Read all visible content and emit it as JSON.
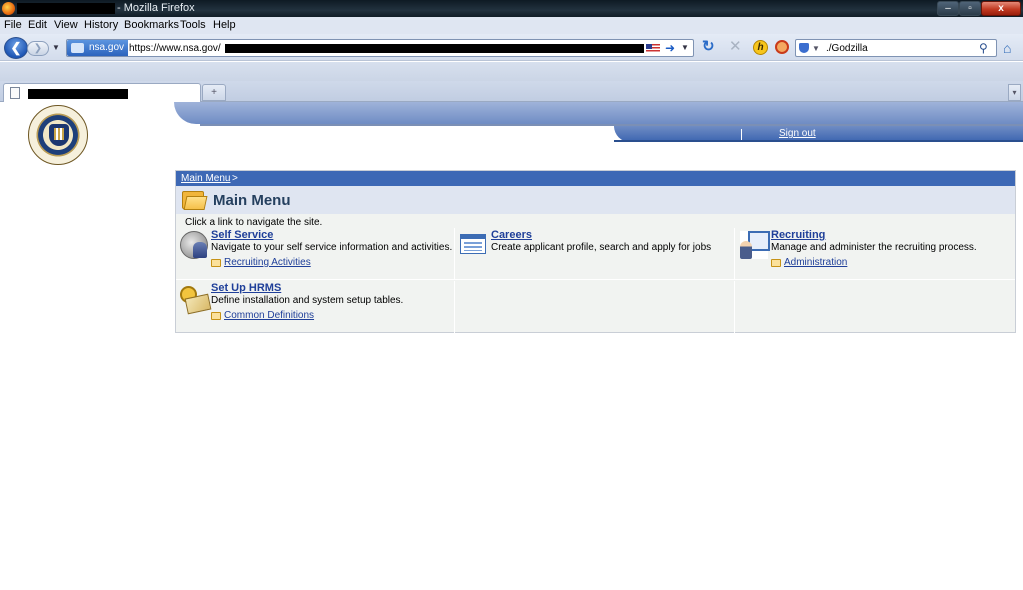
{
  "window": {
    "title_suffix": "- Mozilla Firefox",
    "buttons": {
      "minimize": "–",
      "maximize": "▫",
      "close": "x"
    }
  },
  "menubar": [
    "File",
    "Edit",
    "View",
    "History",
    "Bookmarks",
    "Tools",
    "Help"
  ],
  "navbar": {
    "identity_label": "nsa.gov",
    "url_visible": "https://www.nsa.gov/",
    "search_value": "./Godzilla"
  },
  "tabs": {
    "new_tab_label": "+",
    "list_label": "▾"
  },
  "site": {
    "signout_label": "Sign out"
  },
  "main_menu": {
    "breadcrumb": "Main Menu",
    "breadcrumb_sep": ">",
    "title": "Main Menu",
    "instruction": "Click a link to navigate the site.",
    "items": [
      {
        "label": "Self Service",
        "description": "Navigate to your self service information and activities.",
        "sub_link": "Recruiting Activities",
        "icon": "self-service-icon"
      },
      {
        "label": "Careers",
        "description": "Create applicant profile, search and apply for jobs",
        "sub_link": "",
        "icon": "careers-icon"
      },
      {
        "label": "Recruiting",
        "description": "Manage and administer the recruiting process.",
        "sub_link": "Administration",
        "icon": "recruiting-icon"
      },
      {
        "label": "Set Up HRMS",
        "description": "Define installation and system setup tables.",
        "sub_link": "Common Definitions",
        "icon": "setup-hrms-icon"
      }
    ]
  },
  "colors": {
    "breadcrumb_bar": "#3d68b5",
    "link": "#1f3f99",
    "title_row": "#dfe5f1",
    "panel_bg": "#f1f3f1"
  }
}
